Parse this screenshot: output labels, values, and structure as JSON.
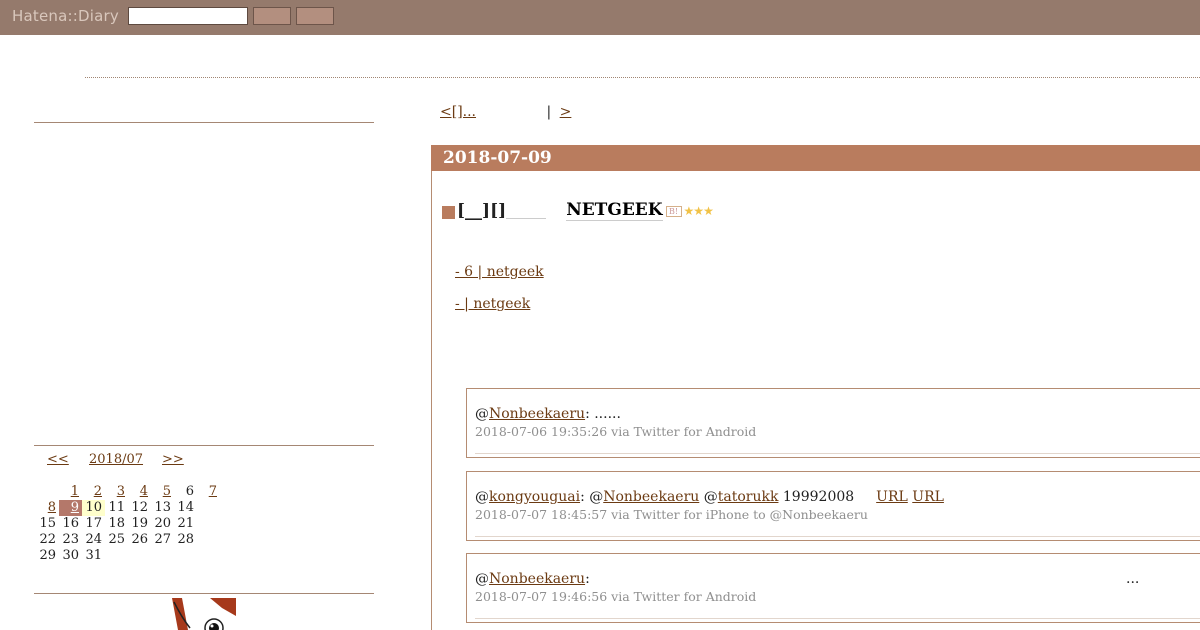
{
  "header": {
    "logo": "Hatena::Diary"
  },
  "pager": {
    "prev": "<[]...",
    "sep": "|",
    "next": ">"
  },
  "day": {
    "date": "2018-07-09"
  },
  "entry": {
    "title_part": "[__][]",
    "title_link": "NETGEEK",
    "stars": "★★★"
  },
  "related": [
    {
      "text": "- 6 | netgeek"
    },
    {
      "text": "-  | netgeek"
    }
  ],
  "calendar": {
    "prev": "<<",
    "month": "2018/07",
    "next": ">>",
    "weeks": [
      [
        "",
        "1",
        "2",
        "3",
        "4",
        "5",
        "6",
        "7"
      ],
      [
        "8",
        "9",
        "10",
        "11",
        "12",
        "13",
        "14"
      ],
      [
        "15",
        "16",
        "17",
        "18",
        "19",
        "20",
        "21"
      ],
      [
        "22",
        "23",
        "24",
        "25",
        "26",
        "27",
        "28"
      ],
      [
        "29",
        "30",
        "31"
      ]
    ]
  },
  "tweets": [
    {
      "at1": "@",
      "user1": "Nonbeekaeru",
      "body": ": ......",
      "meta": "2018-07-06 19:35:26 via Twitter for Android"
    },
    {
      "at1": "@",
      "user1": "kongyouguai",
      "sep1": ": @",
      "user2": "Nonbeekaeru",
      "sep2": " @",
      "user3": "tatorukk",
      "body": " 19992008",
      "url1": "URL",
      "url2": "URL",
      "meta": "2018-07-07 18:45:57 via Twitter for iPhone to @Nonbeekaeru"
    },
    {
      "at1": "@",
      "user1": "Nonbeekaeru",
      "body": ":",
      "tail": "...",
      "meta": "2018-07-07 19:46:56 via Twitter for Android"
    }
  ]
}
